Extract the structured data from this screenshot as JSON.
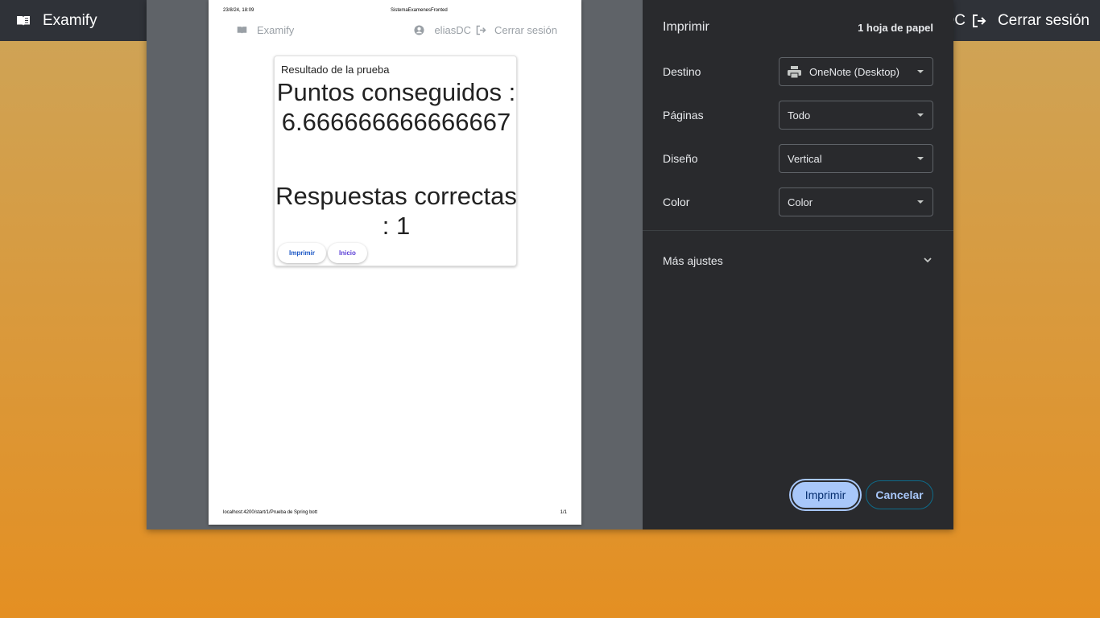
{
  "app": {
    "brand": "Examify",
    "user_fragment": "DC",
    "logout": "Cerrar sesión"
  },
  "preview": {
    "header_date": "23/8/24, 18:09",
    "header_title": "SistemaExamenesFronted",
    "footer_url": "localhost:4200/start/1/Prueba de Spring bott",
    "footer_page": "1/1",
    "nav": {
      "brand": "Examify",
      "user": "eliasDC",
      "logout": "Cerrar sesión"
    },
    "card": {
      "title": "Resultado de la prueba",
      "points_label": "Puntos conseguidos :",
      "points_value": "6.666666666666667",
      "answers_label": "Respuestas correctas : 1",
      "print_button": "Imprimir",
      "home_button": "Inicio"
    }
  },
  "settings": {
    "title": "Imprimir",
    "sheets": "1 hoja de papel",
    "destination": {
      "label": "Destino",
      "value": "OneNote (Desktop)"
    },
    "pages": {
      "label": "Páginas",
      "value": "Todo"
    },
    "layout": {
      "label": "Diseño",
      "value": "Vertical"
    },
    "color": {
      "label": "Color",
      "value": "Color"
    },
    "more": "Más ajustes",
    "print_button": "Imprimir",
    "cancel_button": "Cancelar"
  },
  "colors": {
    "toolbar": "#2f3238",
    "background_top": "#cfa355",
    "background_bottom": "#e48f22",
    "dialog_backdrop": "#5f6368",
    "panel": "#292a2d",
    "primary_button": "#a8c7fa"
  },
  "icons": [
    "book-icon",
    "logout-icon",
    "account-circle-icon",
    "printer-icon",
    "chevron-down-icon"
  ]
}
